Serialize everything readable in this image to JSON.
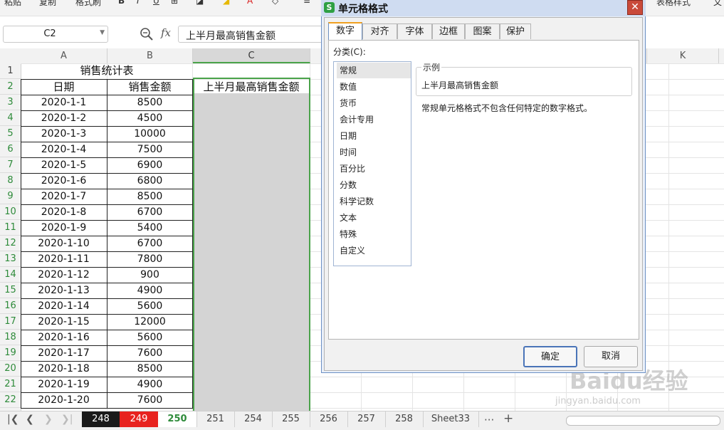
{
  "ribbon": {
    "paste": "粘贴",
    "copy": "复制",
    "format_painter": "格式刷",
    "table_style": "表格样式",
    "more": "文"
  },
  "formula_bar": {
    "name_box": "C2",
    "fx": "fx",
    "content": "上半月最高销售金额"
  },
  "columns": [
    "A",
    "B",
    "C",
    "K"
  ],
  "rows": [
    "1",
    "2",
    "3",
    "4",
    "5",
    "6",
    "7",
    "8",
    "9",
    "10",
    "11",
    "12",
    "13",
    "14",
    "15",
    "16",
    "17",
    "18",
    "19",
    "20",
    "21",
    "22"
  ],
  "sheet": {
    "title": "销售统计表",
    "headers": {
      "date": "日期",
      "amount": "销售金额",
      "c": "上半月最高销售金额"
    },
    "data": [
      {
        "date": "2020-1-1",
        "amount": "8500"
      },
      {
        "date": "2020-1-2",
        "amount": "4500"
      },
      {
        "date": "2020-1-3",
        "amount": "10000"
      },
      {
        "date": "2020-1-4",
        "amount": "7500"
      },
      {
        "date": "2020-1-5",
        "amount": "6900"
      },
      {
        "date": "2020-1-6",
        "amount": "6800"
      },
      {
        "date": "2020-1-7",
        "amount": "8500"
      },
      {
        "date": "2020-1-8",
        "amount": "6700"
      },
      {
        "date": "2020-1-9",
        "amount": "5400"
      },
      {
        "date": "2020-1-10",
        "amount": "6700"
      },
      {
        "date": "2020-1-11",
        "amount": "7800"
      },
      {
        "date": "2020-1-12",
        "amount": "900"
      },
      {
        "date": "2020-1-13",
        "amount": "4900"
      },
      {
        "date": "2020-1-14",
        "amount": "5600"
      },
      {
        "date": "2020-1-15",
        "amount": "12000"
      },
      {
        "date": "2020-1-16",
        "amount": "5600"
      },
      {
        "date": "2020-1-17",
        "amount": "7600"
      },
      {
        "date": "2020-1-18",
        "amount": "8500"
      },
      {
        "date": "2020-1-19",
        "amount": "4900"
      },
      {
        "date": "2020-1-20",
        "amount": "7600"
      }
    ]
  },
  "sheet_tabs": [
    {
      "label": "248",
      "bg": "#1a1a1a",
      "fg": "#ffffff"
    },
    {
      "label": "249",
      "bg": "#e8231f",
      "fg": "#ffffff"
    },
    {
      "label": "250",
      "bg": "#ffffff",
      "fg": "#2e8b3a"
    },
    {
      "label": "251"
    },
    {
      "label": "254"
    },
    {
      "label": "255"
    },
    {
      "label": "256"
    },
    {
      "label": "257"
    },
    {
      "label": "258"
    },
    {
      "label": "Sheet33"
    }
  ],
  "tab_more": "···",
  "tab_add": "+",
  "dialog": {
    "logo": "S",
    "title": "单元格格式",
    "close": "✕",
    "tabs": [
      "数字",
      "对齐",
      "字体",
      "边框",
      "图案",
      "保护"
    ],
    "category_label": "分类(C):",
    "categories": [
      "常规",
      "数值",
      "货币",
      "会计专用",
      "日期",
      "时间",
      "百分比",
      "分数",
      "科学记数",
      "文本",
      "特殊",
      "自定义"
    ],
    "sample_label": "示例",
    "sample_value": "上半月最高销售金额",
    "description": "常规单元格格式不包含任何特定的数字格式。",
    "ok": "确定",
    "cancel": "取消"
  },
  "watermark": {
    "main": "Baidu经验",
    "sub": "jingyan.baidu.com"
  },
  "colors": {
    "selection": "#4aa34a",
    "dialog_border": "#6b8fc4",
    "tab_active_accent": "#f0a020"
  }
}
